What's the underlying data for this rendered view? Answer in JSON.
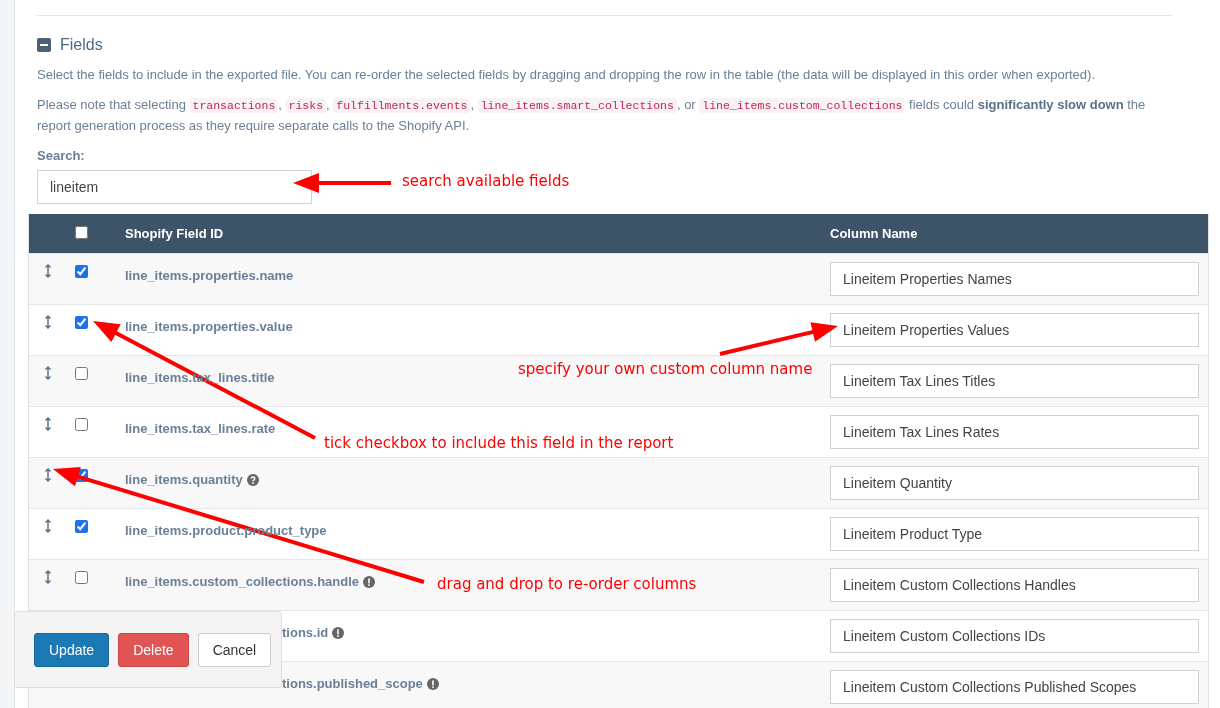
{
  "section": {
    "title": "Fields",
    "expanded": true
  },
  "description": "Select the fields to include in the exported file. You can re-order the selected fields by dragging and dropping the row in the table (the data will be displayed in this order when exported).",
  "note": [
    {
      "kind": "text",
      "text": "Please note that selecting "
    },
    {
      "kind": "code",
      "text": "transactions"
    },
    {
      "kind": "text",
      "text": ", "
    },
    {
      "kind": "code",
      "text": "risks"
    },
    {
      "kind": "text",
      "text": ", "
    },
    {
      "kind": "code",
      "text": "fulfillments.events"
    },
    {
      "kind": "text",
      "text": ", "
    },
    {
      "kind": "code",
      "text": "line_items.smart_collections"
    },
    {
      "kind": "text",
      "text": ", or "
    },
    {
      "kind": "code",
      "text": "line_items.custom_collections"
    },
    {
      "kind": "text",
      "text": " fields could **significantly slow down** the report generation process as they require separate calls to the Shopify API."
    }
  ],
  "search": {
    "label": "Search:",
    "value": "lineitem"
  },
  "table": {
    "select_all": false,
    "columns": [
      "Shopify Field ID",
      "Column Name"
    ],
    "rows": [
      {
        "field": "line_items.properties.name",
        "checked": true,
        "column_name": "Lineitem Properties Names"
      },
      {
        "field": "line_items.properties.value",
        "checked": true,
        "column_name": "Lineitem Properties Values"
      },
      {
        "field": "line_items.tax_lines.title",
        "checked": false,
        "column_name": "Lineitem Tax Lines Titles"
      },
      {
        "field": "line_items.tax_lines.rate",
        "checked": false,
        "column_name": "Lineitem Tax Lines Rates"
      },
      {
        "field": "line_items.quantity",
        "checked": true,
        "kind": "help",
        "column_name": "Lineitem Quantity"
      },
      {
        "field": "line_items.product.product_type",
        "checked": true,
        "column_name": "Lineitem Product Type"
      },
      {
        "field": "line_items.custom_collections.handle",
        "checked": false,
        "kind": "warning",
        "column_name": "Lineitem Custom Collections Handles"
      },
      {
        "field": "tions.id",
        "covered": true,
        "kind": "warning",
        "column_name": "Lineitem Custom Collections IDs"
      },
      {
        "field": "tions.published_scope",
        "covered": true,
        "kind": "warning",
        "column_name": "Lineitem Custom Collections Published Scopes"
      }
    ]
  },
  "annotations": [
    {
      "text": "search available fields"
    },
    {
      "text": "specify your own custom column name"
    },
    {
      "text": "tick checkbox to include this field in the report"
    },
    {
      "text": "drag and drop to re-order columns"
    }
  ],
  "buttons": [
    {
      "label": "Update",
      "kind": "primary"
    },
    {
      "label": "Delete",
      "kind": "danger"
    },
    {
      "label": "Cancel",
      "kind": "default"
    }
  ]
}
